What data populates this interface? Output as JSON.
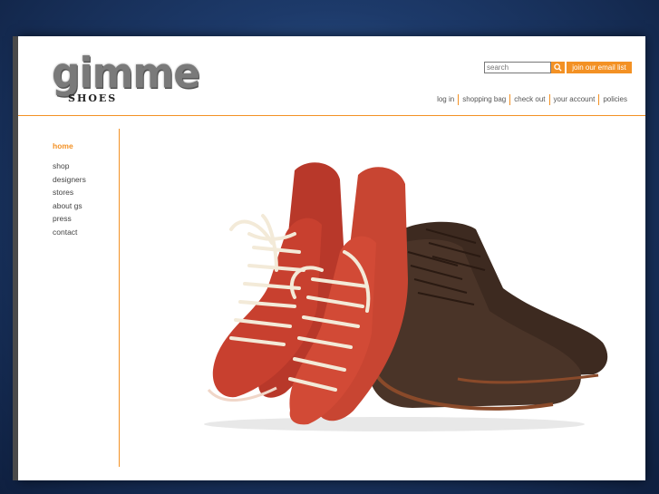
{
  "brand": {
    "logo_word": "gimme",
    "logo_sub": "SHOES"
  },
  "header": {
    "search_placeholder": "search",
    "email_button": "join our email list",
    "nav": [
      "log in",
      "shopping bag",
      "check out",
      "your account",
      "policies"
    ]
  },
  "sidebar": {
    "active": "home",
    "items": [
      "shop",
      "designers",
      "stores",
      "about gs",
      "press",
      "contact"
    ]
  },
  "hero": {
    "image": "red lace-up heeled booties and brown leather brogue boots"
  },
  "colors": {
    "accent": "#f39124",
    "red_shoe": "#c8402f",
    "brown_shoe": "#4a3024"
  }
}
